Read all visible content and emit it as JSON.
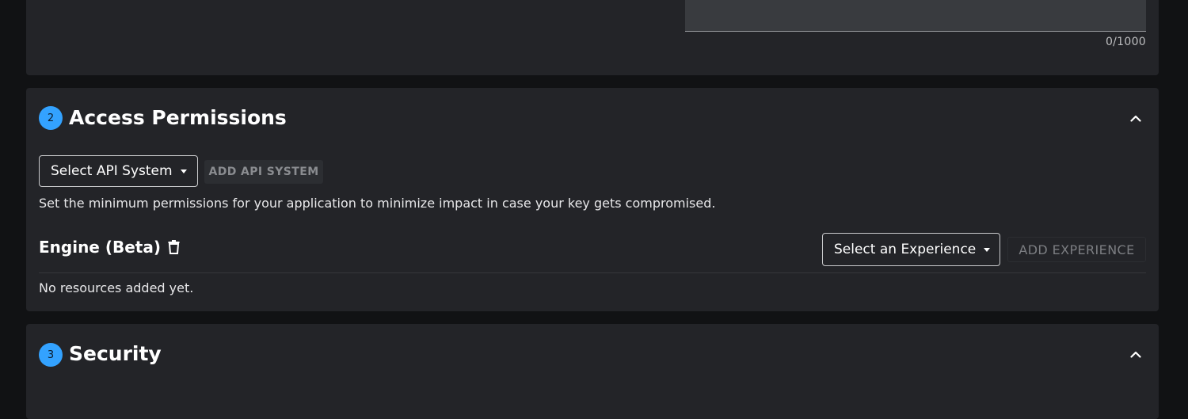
{
  "description_section": {
    "char_counter": "0/1000"
  },
  "access_permissions": {
    "step_number": "2",
    "title": "Access Permissions",
    "api_system_dropdown": "Select API System",
    "add_api_system_button": "ADD API SYSTEM",
    "helper_text": "Set the minimum permissions for your application to minimize impact in case your key gets compromised.",
    "engine": {
      "title": "Engine (Beta)",
      "experience_dropdown": "Select an Experience",
      "add_experience_button": "ADD EXPERIENCE",
      "empty_text": "No resources added yet."
    }
  },
  "security": {
    "step_number": "3",
    "title": "Security"
  },
  "icons": {
    "collapse": "chevron-up-icon",
    "delete": "trash-icon",
    "dropdown": "caret-down-icon"
  },
  "colors": {
    "accent": "#33a2ff",
    "card_background": "#232428",
    "page_background": "#111214"
  }
}
